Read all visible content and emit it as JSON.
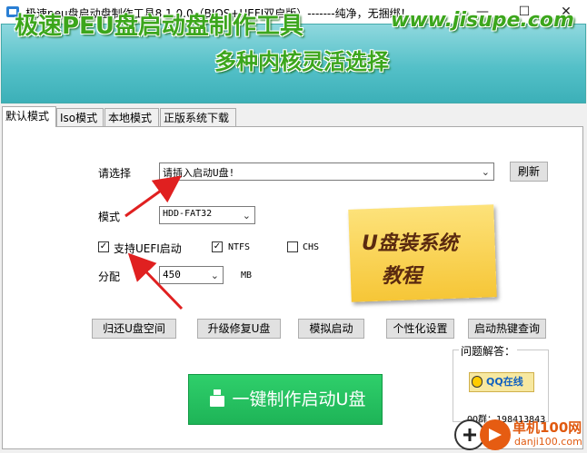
{
  "window": {
    "title": "极速peu盘启动盘制作工具8.1.0.0（BIOS+UEFI双启版）-------纯净，无捆绑！",
    "minimize": "—",
    "maximize": "☐",
    "close": "✕"
  },
  "banner": {
    "title": "极速PEU盘启动盘制作工具",
    "url": "www.jisupe.com",
    "subtitle": "多种内核灵活选择"
  },
  "tabs": [
    {
      "label": "默认模式",
      "active": true
    },
    {
      "label": "Iso模式",
      "active": false
    },
    {
      "label": "本地模式",
      "active": false
    },
    {
      "label": "正版系统下载",
      "active": false
    }
  ],
  "form": {
    "select_label": "请选择",
    "device_value": "请插入启动U盘!",
    "refresh_label": "刷新",
    "mode_label": "模式",
    "mode_value": "HDD-FAT32",
    "uefi_label": "支持UEFI启动",
    "uefi_checked": true,
    "ntfs_label": "NTFS",
    "ntfs_checked": true,
    "chs_label": "CHS",
    "chs_checked": false,
    "alloc_label": "分配",
    "alloc_value": "450",
    "alloc_unit": "MB"
  },
  "actions": {
    "restore": "归还U盘空间",
    "upgrade": "升级修复U盘",
    "simulate": "模拟启动",
    "personalize": "个性化设置",
    "hotkey": "启动热键查询",
    "make": "一键制作启动U盘"
  },
  "note": {
    "line1": "U盘装系统",
    "line2": "教程"
  },
  "help": {
    "title": "问题解答：",
    "qq_button": "QQ在线",
    "qq_group": "QQ群：198413843"
  },
  "watermark": {
    "name": "单机100网",
    "url": "danji100.com"
  },
  "colors": {
    "banner_text": "#3ca61c",
    "make_button": "#1eb457",
    "arrow": "#e02020"
  }
}
